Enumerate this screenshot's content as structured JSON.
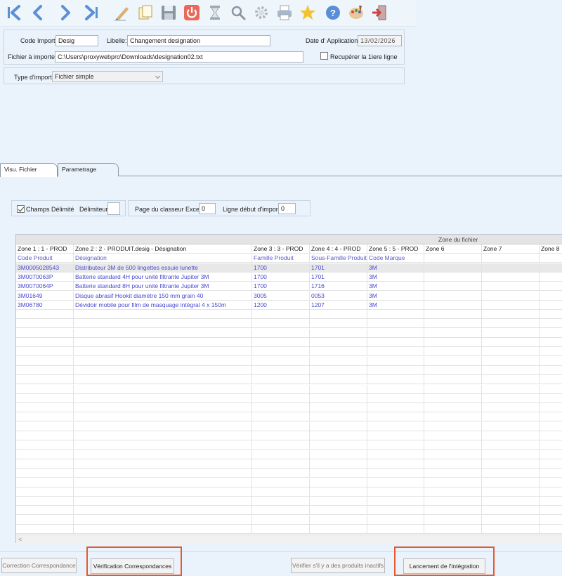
{
  "toolbar": {
    "icons": [
      "first-icon",
      "prev-icon",
      "next-icon",
      "last-icon",
      "edit-icon",
      "copy-icon",
      "save-icon",
      "power-icon",
      "hourglass-icon",
      "search-icon",
      "settings-icon",
      "print-icon",
      "star-icon",
      "help-icon",
      "palette-icon",
      "exit-icon"
    ]
  },
  "form": {
    "code_import_label": "Code Import:",
    "code_import_value": "Desig",
    "libelle_label": "Libelle:",
    "libelle_value": "Changement designation",
    "date_label": "Date d' Application:",
    "date_value": "13/02/2026",
    "fichier_label": "Fichier à importer:",
    "fichier_value": "C:\\Users\\proxywebpro\\Downloads\\designation02.txt",
    "recup_label": "Recupérer la 1iere ligne",
    "type_label": "Type d'import:",
    "type_value": "Fichier simple"
  },
  "tabs": [
    {
      "label": "Visu. Fichier",
      "active": true
    },
    {
      "label": "Parametrage",
      "active": false
    }
  ],
  "options": {
    "champs_label": "Champs Délimité",
    "delim_label": "Délimiteur:",
    "delim_value": "",
    "page_label": "Page du classeur Excel:",
    "page_value": "0",
    "ligne_label": "Ligne début d'import:",
    "ligne_value": "0"
  },
  "grid": {
    "zone_title": "Zone du fichier",
    "headers": [
      "Zone 1 :     1 - PROD",
      "Zone 2 :     2 - PRODUIT.desig - Désignation",
      "Zone 3 :     3 - PROD",
      "Zone 4 :     4 - PROD",
      "Zone 5 :     5 - PROD",
      "Zone 6",
      "Zone 7",
      "Zone 8"
    ],
    "subheaders": [
      "Code Produit",
      "Désignation",
      "Famille Produit",
      "Sous-Famille Produit",
      "Code Marque",
      "",
      "",
      ""
    ],
    "rows": [
      [
        "3M0005028543",
        "Distributeur 3M de 500 lingettes essuie lunette",
        "1700",
        "1701",
        "3M"
      ],
      [
        "3M0070063P",
        "Batterie standard 4H pour unité filtrante Jupiter 3M",
        "1700",
        "1701",
        "3M"
      ],
      [
        "3M0070064P",
        "Batterie standard 8H pour unité filtrante Jupiter 3M",
        "1700",
        "1716",
        "3M"
      ],
      [
        "3M01649",
        "Disque abrasif Hookit diamètre 150 mm grain 40",
        "3005",
        "0053",
        "3M"
      ],
      [
        "3M06780",
        "Dévidoir mobile pour film de masquage intégral 4 x 150m",
        "1200",
        "1207",
        "3M"
      ]
    ],
    "scroll_left": "<"
  },
  "buttons": {
    "correction": "Correction Correspondance",
    "verification": "Vérification Correspondances",
    "verifier_inactifs": "Vérifier s'il y a des produits inactifs",
    "lancement": "Lancement de l'intégration"
  },
  "colors": {
    "highlight": "#e8592a",
    "link_text": "#4a4ad0",
    "background": "#eaf3fc"
  }
}
